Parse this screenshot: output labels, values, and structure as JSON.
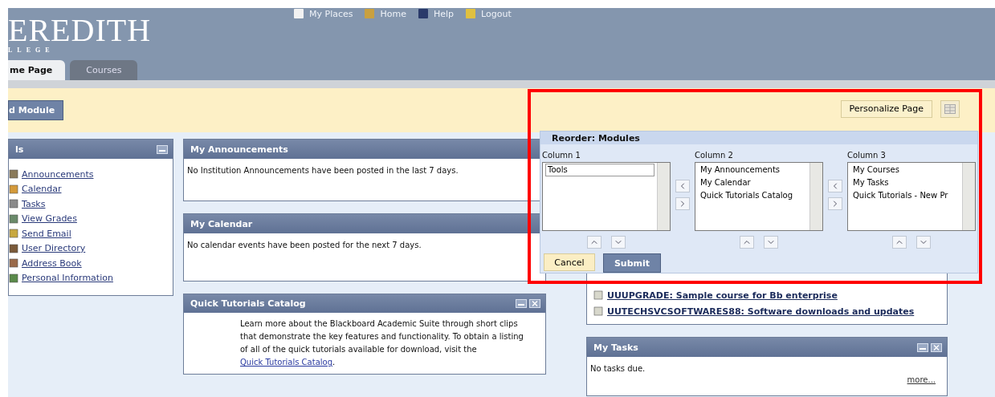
{
  "header": {
    "logo": "EREDITH",
    "logo_sub": "LLEGE",
    "nav": [
      {
        "label": "My Places"
      },
      {
        "label": "Home"
      },
      {
        "label": "Help"
      },
      {
        "label": "Logout"
      }
    ],
    "tabs": [
      {
        "label": "me Page",
        "selected": true
      },
      {
        "label": "Courses",
        "selected": false
      }
    ]
  },
  "toolbar": {
    "add_module": "d Module",
    "personalize": "Personalize Page"
  },
  "tools": {
    "title": "ls",
    "items": [
      {
        "label": "Announcements",
        "color": "#8a7a5a"
      },
      {
        "label": "Calendar",
        "color": "#d49a3a"
      },
      {
        "label": "Tasks",
        "color": "#8a8a8a"
      },
      {
        "label": "View Grades",
        "color": "#6a8a6a"
      },
      {
        "label": "Send Email",
        "color": "#c8a840"
      },
      {
        "label": "User Directory",
        "color": "#7a5a3a"
      },
      {
        "label": "Address Book",
        "color": "#9a6a4a"
      },
      {
        "label": "Personal Information",
        "color": "#5a8a4a"
      }
    ]
  },
  "modules": [
    {
      "title": "My Announcements",
      "body": "No Institution Announcements have been posted in the last 7 days."
    },
    {
      "title": "My Calendar",
      "body": "No calendar events have been posted for the next 7 days."
    },
    {
      "title": "Quick Tutorials Catalog",
      "body": "Learn more about the Blackboard Academic Suite through short clips that demonstrate the key features and functionality. To obtain a listing of all of the quick tutorials available for download, visit the ",
      "link": "Quick Tutorials Catalog",
      "after": "."
    }
  ],
  "courses": {
    "items": [
      {
        "label": "UUUPGRADE: Sample course for Bb enterprise"
      },
      {
        "label": "UUTECHSVCSOFTWARES88: Software downloads and updates"
      }
    ]
  },
  "tasks": {
    "title": "My Tasks",
    "body": "No tasks due.",
    "more": "more..."
  },
  "reorder": {
    "title": "Reorder: Modules",
    "columns": [
      {
        "label": "Column 1",
        "items": [
          {
            "label": "Tools",
            "selected": true
          }
        ]
      },
      {
        "label": "Column 2",
        "items": [
          {
            "label": "My Announcements",
            "selected": false
          },
          {
            "label": "My Calendar",
            "selected": false
          },
          {
            "label": "Quick Tutorials Catalog",
            "selected": false
          }
        ]
      },
      {
        "label": "Column 3",
        "items": [
          {
            "label": "My Courses",
            "selected": false
          },
          {
            "label": "My Tasks",
            "selected": false
          },
          {
            "label": "Quick Tutorials - New Pr",
            "selected": false
          }
        ]
      }
    ],
    "cancel": "Cancel",
    "submit": "Submit"
  }
}
